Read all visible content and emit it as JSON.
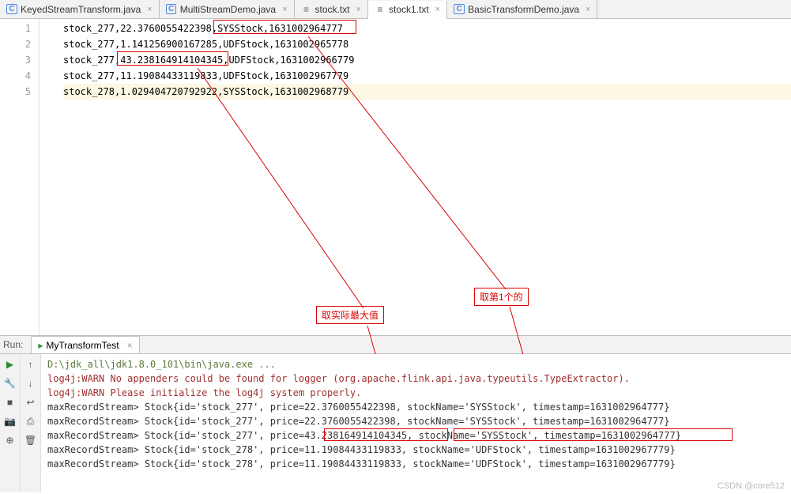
{
  "tabs": [
    {
      "label": "KeyedStreamTransform.java",
      "type": "java"
    },
    {
      "label": "MultiStreamDemo.java",
      "type": "java"
    },
    {
      "label": "stock.txt",
      "type": "txt"
    },
    {
      "label": "stock1.txt",
      "type": "txt",
      "active": true
    },
    {
      "label": "BasicTransformDemo.java",
      "type": "java"
    }
  ],
  "editor": {
    "lines": [
      "stock_277,22.3760055422398,SYSStock,1631002964777",
      "stock_277,1.141256900167285,UDFStock,1631002965778",
      "stock_277,43.238164914104345,UDFStock,1631002966779",
      "stock_277,11.19084433119833,UDFStock,1631002967779",
      "stock_278,1.029404720792922,SYSStock,1631002968779"
    ],
    "hl_index": 4
  },
  "annotations": {
    "label1": "取实际最大值",
    "label2": "取第1个的"
  },
  "run": {
    "label": "Run:",
    "tab": "MyTransformTest"
  },
  "console": {
    "lines": [
      {
        "cls": "cmd",
        "text": "D:\\jdk_all\\jdk1.8.0_101\\bin\\java.exe ..."
      },
      {
        "cls": "warn",
        "text": "log4j:WARN No appenders could be found for logger (org.apache.flink.api.java.typeutils.TypeExtractor)."
      },
      {
        "cls": "warn",
        "text": "log4j:WARN Please initialize the log4j system properly."
      },
      {
        "cls": "norm",
        "text": "maxRecordStream> Stock{id='stock_277', price=22.3760055422398, stockName='SYSStock', timestamp=1631002964777}"
      },
      {
        "cls": "norm",
        "text": "maxRecordStream> Stock{id='stock_277', price=22.3760055422398, stockName='SYSStock', timestamp=1631002964777}"
      },
      {
        "cls": "norm",
        "text": "maxRecordStream> Stock{id='stock_277', price=43.238164914104345, stockName='SYSStock', timestamp=1631002964777}"
      },
      {
        "cls": "norm",
        "text": "maxRecordStream> Stock{id='stock_278', price=11.19084433119833, stockName='UDFStock', timestamp=1631002967779}"
      },
      {
        "cls": "norm",
        "text": "maxRecordStream> Stock{id='stock_278', price=11.19084433119833, stockName='UDFStock', timestamp=1631002967779}"
      }
    ]
  },
  "watermark": "CSDN @core512",
  "tool_icons": {
    "play": "▶",
    "wrench": "🔧",
    "stop": "■",
    "camera": "📷",
    "up": "↑",
    "down": "↓",
    "print": "⎙",
    "wrap": "↩",
    "trash": "🗑",
    "target": "⊕"
  }
}
